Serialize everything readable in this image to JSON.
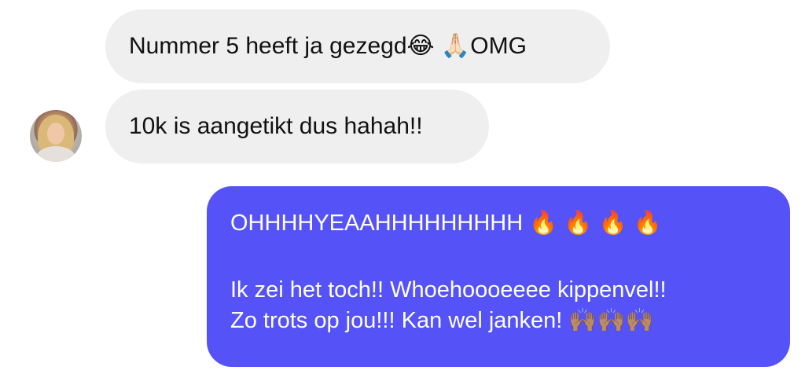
{
  "messages": {
    "incoming": [
      {
        "text": "Nummer 5 heeft ja gezegd😂 🙏🏻OMG"
      },
      {
        "text": "10k is aangetikt dus hahah!!"
      }
    ],
    "outgoing": {
      "line1": "OHHHHYEAAHHHHHHHHH 🔥 🔥 🔥 🔥",
      "line2": "Ik zei het toch!! Whoehoooeeee kippenvel!!",
      "line3": "Zo trots op jou!!! Kan wel janken! 🙌🏽🙌🏽🙌🏽"
    }
  },
  "colors": {
    "incoming_bubble": "#efefef",
    "outgoing_bubble": "#5553f8",
    "incoming_text": "#111111",
    "outgoing_text": "#ffffff"
  }
}
